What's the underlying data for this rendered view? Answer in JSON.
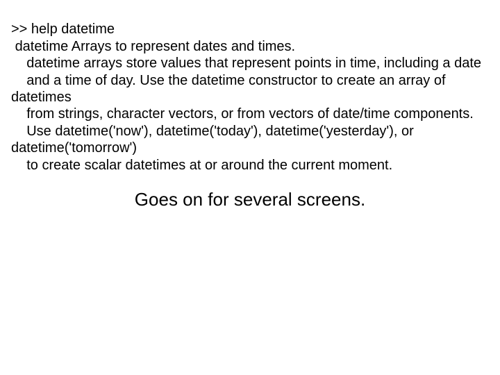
{
  "help": {
    "line1": ">> help datetime",
    "line2": " datetime Arrays to represent dates and times.",
    "line3": "    datetime arrays store values that represent points in time, including a date",
    "line4": "    and a time of day. Use the datetime constructor to create an array of datetimes",
    "line5": "    from strings, character vectors, or from vectors of date/time components.",
    "line6": "    Use datetime('now'), datetime('today'), datetime('yesterday'), or datetime('tomorrow')",
    "line7": "    to create scalar datetimes at or around the current moment."
  },
  "caption": "Goes on for several screens."
}
